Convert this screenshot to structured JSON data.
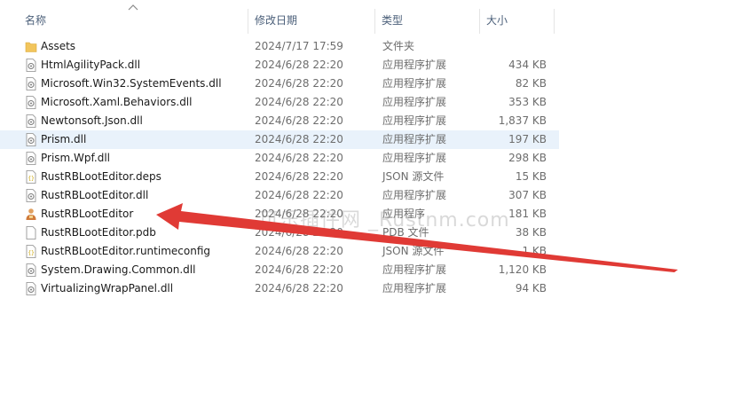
{
  "columns": {
    "name": "名称",
    "date": "修改日期",
    "type": "类型",
    "size": "大小"
  },
  "files": [
    {
      "name": "Assets",
      "date": "2024/7/17 17:59",
      "type": "文件夹",
      "size": "",
      "icon": "folder-icon"
    },
    {
      "name": "HtmlAgilityPack.dll",
      "date": "2024/6/28 22:20",
      "type": "应用程序扩展",
      "size": "434 KB",
      "icon": "dll-icon"
    },
    {
      "name": "Microsoft.Win32.SystemEvents.dll",
      "date": "2024/6/28 22:20",
      "type": "应用程序扩展",
      "size": "82 KB",
      "icon": "dll-icon"
    },
    {
      "name": "Microsoft.Xaml.Behaviors.dll",
      "date": "2024/6/28 22:20",
      "type": "应用程序扩展",
      "size": "353 KB",
      "icon": "dll-icon"
    },
    {
      "name": "Newtonsoft.Json.dll",
      "date": "2024/6/28 22:20",
      "type": "应用程序扩展",
      "size": "1,837 KB",
      "icon": "dll-icon"
    },
    {
      "name": "Prism.dll",
      "date": "2024/6/28 22:20",
      "type": "应用程序扩展",
      "size": "197 KB",
      "icon": "dll-icon",
      "selected": true
    },
    {
      "name": "Prism.Wpf.dll",
      "date": "2024/6/28 22:20",
      "type": "应用程序扩展",
      "size": "298 KB",
      "icon": "dll-icon"
    },
    {
      "name": "RustRBLootEditor.deps",
      "date": "2024/6/28 22:20",
      "type": "JSON 源文件",
      "size": "15 KB",
      "icon": "json-icon"
    },
    {
      "name": "RustRBLootEditor.dll",
      "date": "2024/6/28 22:20",
      "type": "应用程序扩展",
      "size": "307 KB",
      "icon": "dll-icon"
    },
    {
      "name": "RustRBLootEditor",
      "date": "2024/6/28 22:20",
      "type": "应用程序",
      "size": "181 KB",
      "icon": "app-icon"
    },
    {
      "name": "RustRBLootEditor.pdb",
      "date": "2024/6/28 22:20",
      "type": "PDB 文件",
      "size": "38 KB",
      "icon": "file-icon"
    },
    {
      "name": "RustRBLootEditor.runtimeconfig",
      "date": "2024/6/28 22:20",
      "type": "JSON 源文件",
      "size": "1 KB",
      "icon": "json-icon"
    },
    {
      "name": "System.Drawing.Common.dll",
      "date": "2024/6/28 22:20",
      "type": "应用程序扩展",
      "size": "1,120 KB",
      "icon": "dll-icon"
    },
    {
      "name": "VirtualizingWrapPanel.dll",
      "date": "2024/6/28 22:20",
      "type": "应用程序扩展",
      "size": "94 KB",
      "icon": "dll-icon"
    }
  ],
  "watermark": "可乐插件网 _Rustnm.com",
  "colors": {
    "selection": "#e9f2fb",
    "header_text": "#4c607a",
    "arrow": "#e03a35",
    "folder": "#f2c55c"
  }
}
